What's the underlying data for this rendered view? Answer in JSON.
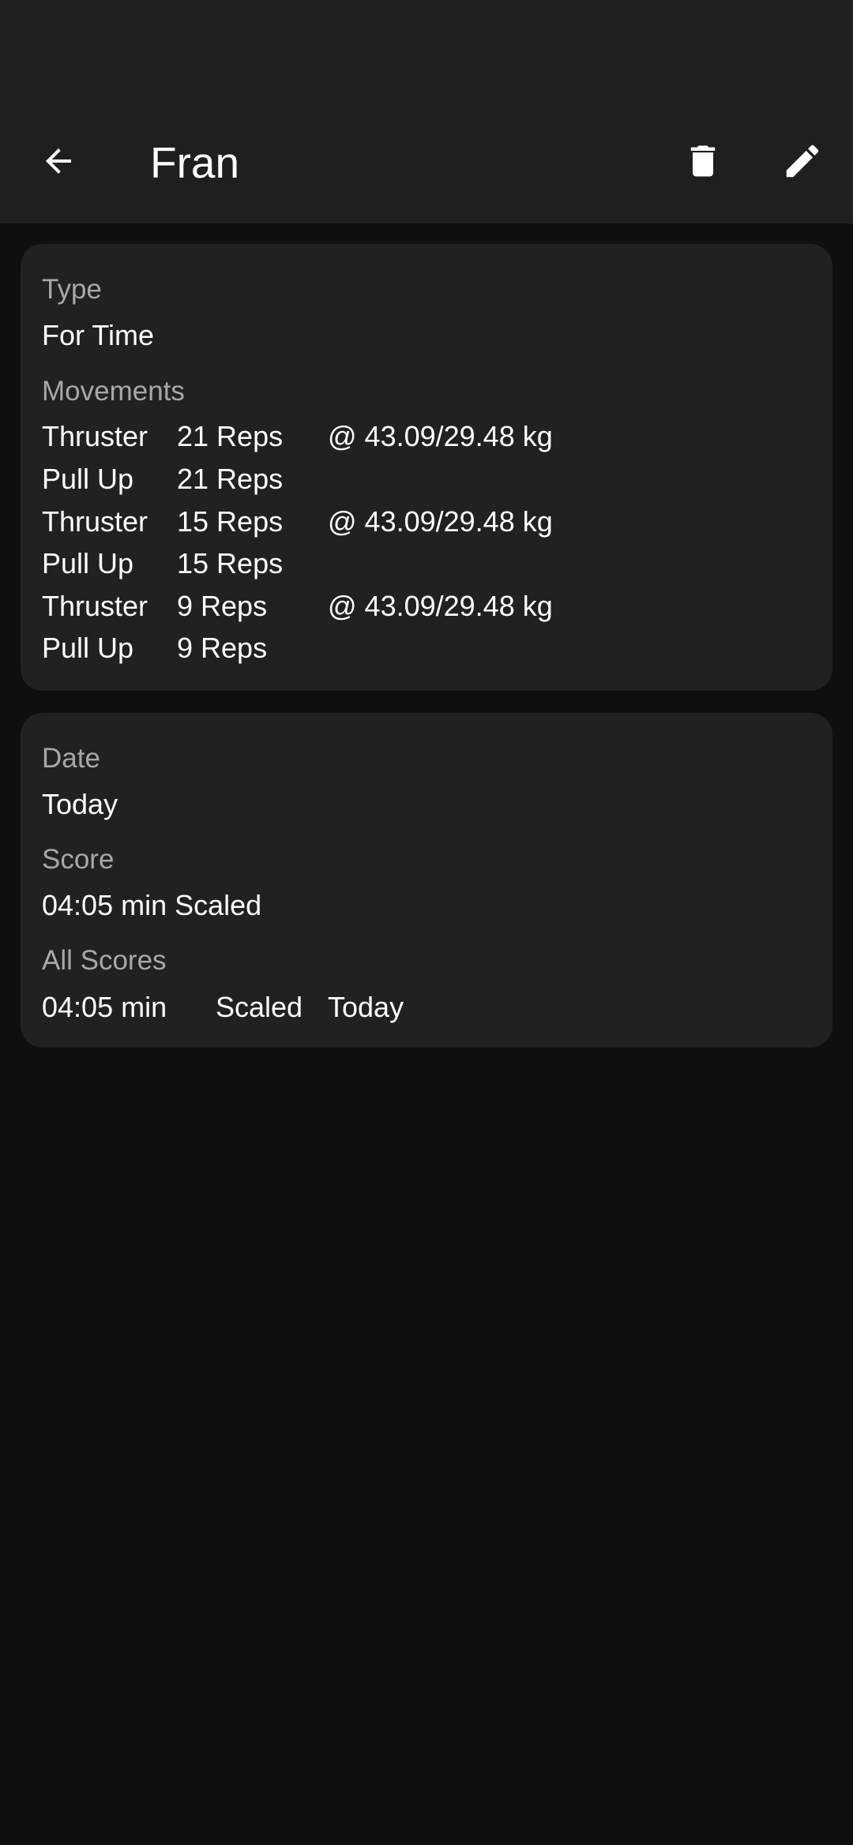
{
  "appbar": {
    "title": "Fran",
    "back_icon": "arrow-back-icon",
    "delete_icon": "trash-icon",
    "edit_icon": "pencil-icon"
  },
  "workout": {
    "type_label": "Type",
    "type_value": "For Time",
    "movements_label": "Movements",
    "movements": [
      {
        "name": "Thruster",
        "reps": "21 Reps",
        "weight": "@ 43.09/29.48 kg"
      },
      {
        "name": "Pull Up",
        "reps": "21 Reps",
        "weight": ""
      },
      {
        "name": "Thruster",
        "reps": "15 Reps",
        "weight": "@ 43.09/29.48 kg"
      },
      {
        "name": "Pull Up",
        "reps": "15 Reps",
        "weight": ""
      },
      {
        "name": "Thruster",
        "reps": "9 Reps",
        "weight": "@ 43.09/29.48 kg"
      },
      {
        "name": "Pull Up",
        "reps": "9 Reps",
        "weight": ""
      }
    ]
  },
  "result": {
    "date_label": "Date",
    "date_value": "Today",
    "score_label": "Score",
    "score_value": "04:05 min Scaled",
    "all_scores_label": "All Scores",
    "all_scores": [
      {
        "time": "04:05 min",
        "scaling": "Scaled",
        "date": "Today"
      }
    ]
  },
  "colors": {
    "background": "#0f0f0f",
    "surface": "#1f1f1f",
    "card": "#212121",
    "label": "#a8a8a8",
    "text": "#ffffff"
  }
}
